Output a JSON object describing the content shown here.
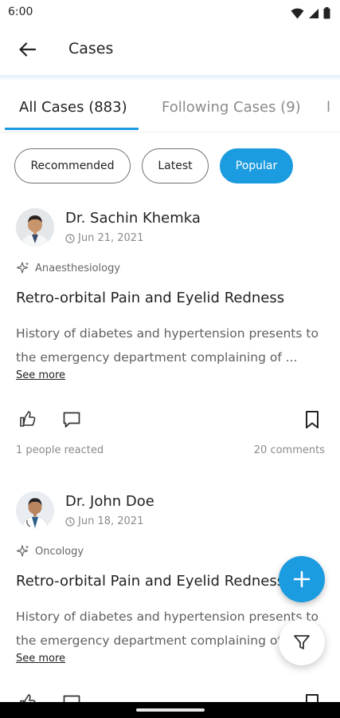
{
  "status_bar": {
    "time": "6:00"
  },
  "header": {
    "title": "Cases"
  },
  "tabs": [
    {
      "label": "All Cases (883)",
      "active": true
    },
    {
      "label": "Following Cases (9)",
      "active": false
    }
  ],
  "filters": [
    {
      "label": "Recommended",
      "selected": false
    },
    {
      "label": "Latest",
      "selected": false
    },
    {
      "label": "Popular",
      "selected": true
    }
  ],
  "cases": [
    {
      "author": "Dr. Sachin Khemka",
      "date": "Jun 21, 2021",
      "specialty": "Anaesthesiology",
      "title": "Retro-orbital Pain and Eyelid Redness",
      "description": "History of diabetes and hypertension presents to the emergency department complaining of ...",
      "see_more": "See more",
      "reactions": "1 people reacted",
      "comments": "20 comments"
    },
    {
      "author": "Dr. John Doe",
      "date": "Jun 18, 2021",
      "specialty": "Oncology",
      "title": "Retro-orbital Pain and Eyelid Redness",
      "description": "History of diabetes and hypertension presents to the emergency department complaining of ...",
      "see_more": "See more"
    }
  ],
  "colors": {
    "accent": "#1b9be0",
    "text": "#222222",
    "muted": "#8a8a8a"
  },
  "icons": [
    "wifi-icon",
    "signal-icon",
    "battery-icon",
    "back-arrow-icon",
    "clock-icon",
    "sparkle-icon",
    "thumbs-up-icon",
    "comment-icon",
    "bookmark-icon",
    "plus-icon",
    "filter-icon"
  ]
}
